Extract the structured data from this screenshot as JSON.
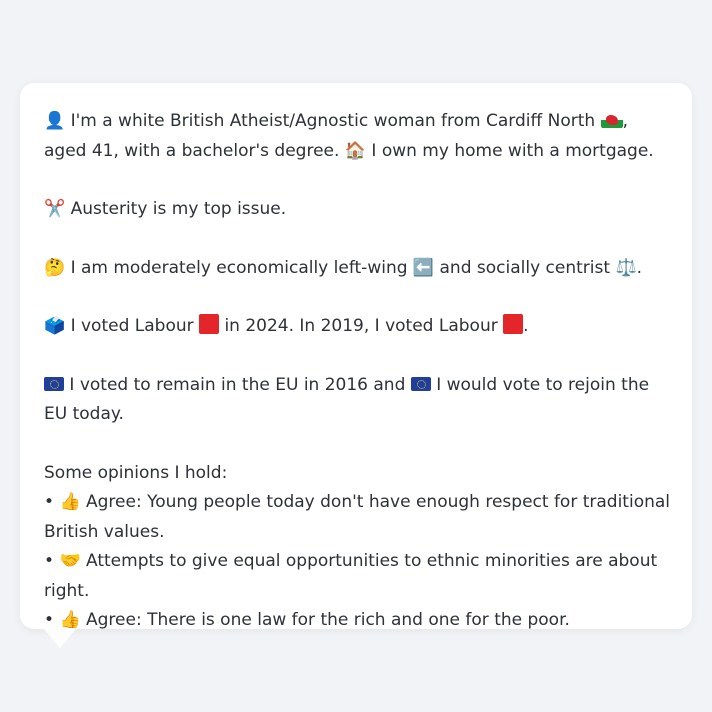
{
  "profile": {
    "intro_icon": "person-silhouette-icon",
    "intro_text_1": "I'm a white British Atheist/Agnostic woman from Cardiff North",
    "intro_flag": "wales-flag-icon",
    "intro_text_2": ", aged 41, with a bachelor's degree.",
    "home_icon": "house-icon",
    "home_text": "I own my home with a mortgage.",
    "issue_icon": "scissors-icon",
    "issue_text": "Austerity is my top issue.",
    "ideology_icon": "thinking-face-icon",
    "ideology_text_1": "I am moderately economically left-wing",
    "left_arrow_icon": "left-arrow-icon",
    "ideology_text_2": "and socially centrist",
    "scales_icon": "balance-scale-icon",
    "ideology_text_3": ".",
    "vote_icon": "ballot-box-icon",
    "vote_text_1": "I voted Labour",
    "labour_icon": "red-square-icon",
    "vote_text_2": "in 2024. In 2019, I voted Labour",
    "vote_text_3": ".",
    "eu_icon": "eu-flag-icon",
    "eu_text_1": "I voted to remain in the EU in 2016 and",
    "eu_text_2": "I would vote to rejoin the EU today.",
    "opinions_heading": "Some opinions I hold:",
    "opinions": [
      {
        "bullet": "•",
        "icon": "thumbs-up-icon",
        "text": "Agree: Young people today don't have enough respect for traditional British values."
      },
      {
        "bullet": "•",
        "icon": "handshake-icon",
        "text": "Attempts to give equal opportunities to ethnic minorities are about right."
      },
      {
        "bullet": "•",
        "icon": "thumbs-up-icon",
        "text": "Agree: There is one law for the rich and one for the poor."
      }
    ]
  },
  "colors": {
    "background": "#f1f3f6",
    "card": "#ffffff",
    "text": "#2d3138",
    "labour_red": "#e4252a",
    "eu_blue": "#1f3f9b"
  }
}
